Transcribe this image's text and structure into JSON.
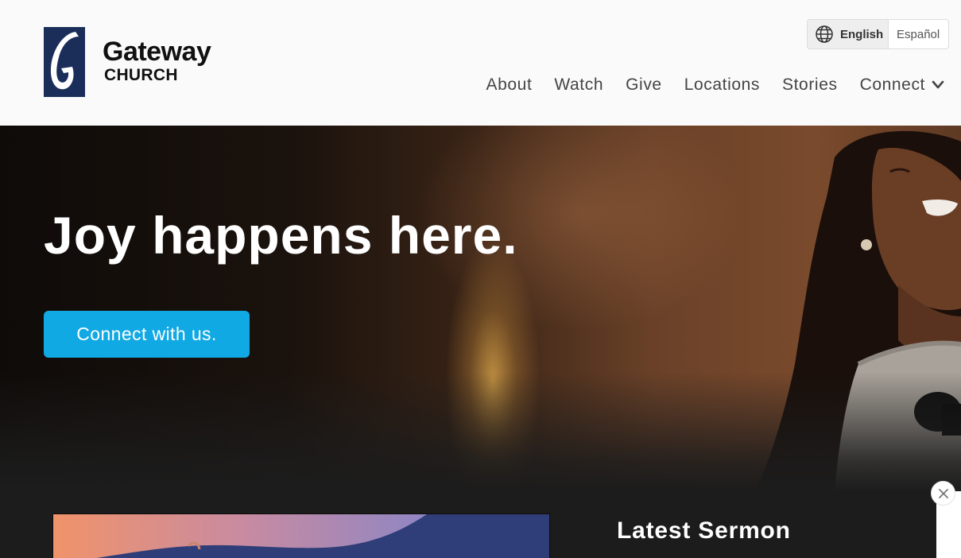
{
  "brand": {
    "name": "Gateway",
    "sub": "CHURCH",
    "logo_color": "#1b2e5a"
  },
  "language": {
    "active": "English",
    "other": "Español"
  },
  "nav": {
    "items": [
      {
        "label": "About"
      },
      {
        "label": "Watch"
      },
      {
        "label": "Give"
      },
      {
        "label": "Locations"
      },
      {
        "label": "Stories"
      },
      {
        "label": "Connect",
        "has_dropdown": true
      }
    ]
  },
  "hero": {
    "headline": "Joy happens here.",
    "cta_label": "Connect with us.",
    "cta_color": "#10a9e3"
  },
  "sermon": {
    "section_title": "Latest Sermon"
  },
  "icons": {
    "language": "globe-icon",
    "dropdown": "chevron-down-icon",
    "close": "close-icon"
  }
}
